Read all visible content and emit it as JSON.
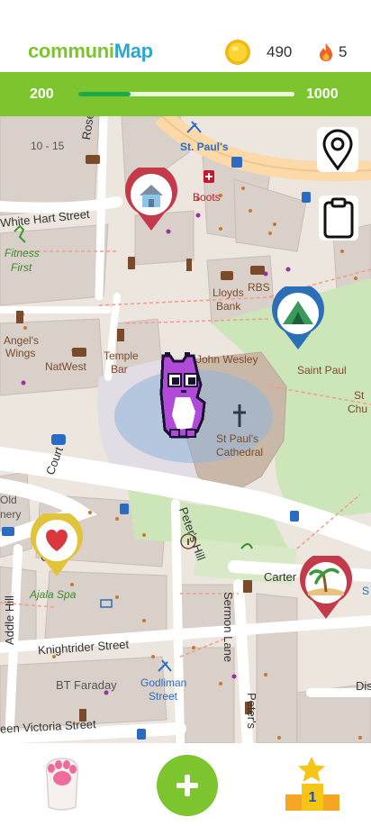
{
  "header": {
    "logo_part1": "communi",
    "logo_part2": "Map",
    "coins": "490",
    "streak": "5"
  },
  "progress": {
    "min": "200",
    "max": "1000",
    "fraction": 0.24
  },
  "map": {
    "labels": {
      "st_pauls": "St. Paul's",
      "boots": "Boots",
      "white_hart": "White Hart Street",
      "fitness": "Fitness",
      "first": "First",
      "rose": "Rose Street",
      "ten_fifteen": "10 - 15",
      "lloyds": "Lloyds",
      "bank": "Bank",
      "rbs": "RBS",
      "angels": "Angel's",
      "wings": "Wings",
      "natwest": "NatWest",
      "temple": "Temple",
      "bar": "Bar",
      "john_wesley": "John Wesley",
      "saint_paul": "Saint Paul",
      "st_pauls_cathedral_1": "St Paul's",
      "st_pauls_cathedral_2": "Cathedral",
      "st": "St",
      "chu": "Chu",
      "old": "Old",
      "nery": "nery",
      "court": "Court",
      "car": "Car",
      "peters_hill": "Peter's Hill",
      "carter": "Carter",
      "ajala": "Ajala Spa",
      "addle": "Addle Hill",
      "sermon": "Sermon Lane",
      "knightrider": "Knightrider Street",
      "bt": "BT Faraday",
      "godliman1": "Godliman",
      "godliman2": "Street",
      "victoria": "een Victoria Street",
      "peters2": "Peter's",
      "dis": "Dis",
      "s": "S"
    }
  },
  "colors": {
    "brand_green": "#7cc52e",
    "brand_blue": "#2ea7c9",
    "pin_red": "#c33b4b",
    "pin_blue": "#2b6fb8",
    "pin_yellow": "#e2c43a"
  },
  "icons": {
    "coin": "coin-icon",
    "fire": "fire-icon",
    "location": "map-pin-outline-icon",
    "clipboard": "clipboard-icon",
    "paw": "paw-icon",
    "add": "plus-icon",
    "leaderboard": "podium-icon"
  }
}
